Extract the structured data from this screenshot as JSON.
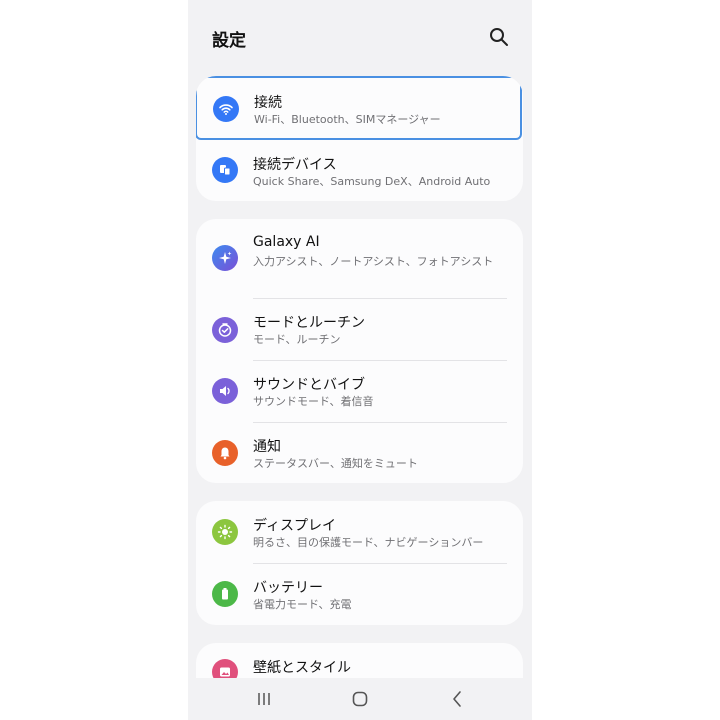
{
  "header": {
    "title": "設定",
    "search_icon": "search-icon"
  },
  "colors": {
    "background": "#f2f2f4",
    "card": "#fcfcfd",
    "focus_border": "#4a90e2",
    "connections": "#3478f6",
    "devices": "#3478f6",
    "ai": "#4f6bdc",
    "modes": "#7b61d9",
    "sound": "#7b61d9",
    "notifications": "#e8612a",
    "display": "#8cc63f",
    "battery": "#4cb848",
    "wallpaper": "#e0507c"
  },
  "groups": [
    {
      "items": [
        {
          "label": "接続",
          "sub": "Wi-Fi、Bluetooth、SIMマネージャー",
          "icon": "wifi-icon",
          "focused": true
        },
        {
          "label": "接続デバイス",
          "sub": "Quick Share、Samsung DeX、Android Auto",
          "icon": "connected-devices-icon"
        }
      ]
    },
    {
      "items": [
        {
          "label": "Galaxy AI",
          "sub": "入力アシスト、ノートアシスト、フォトアシスト",
          "icon": "sparkle-icon"
        },
        {
          "label": "モードとルーチン",
          "sub": "モード、ルーチン",
          "icon": "check-clock-icon"
        },
        {
          "label": "サウンドとバイブ",
          "sub": "サウンドモード、着信音",
          "icon": "speaker-icon"
        },
        {
          "label": "通知",
          "sub": "ステータスバー、通知をミュート",
          "icon": "bell-icon"
        }
      ]
    },
    {
      "items": [
        {
          "label": "ディスプレイ",
          "sub": "明るさ、目の保護モード、ナビゲーションバー",
          "icon": "sun-icon"
        },
        {
          "label": "バッテリー",
          "sub": "省電力モード、充電",
          "icon": "battery-icon"
        }
      ]
    },
    {
      "items": [
        {
          "label": "壁紙とスタイル",
          "icon": "wallpaper-icon"
        }
      ]
    }
  ],
  "navbar": {
    "recents": "recents-icon",
    "home": "home-icon",
    "back": "back-icon"
  }
}
